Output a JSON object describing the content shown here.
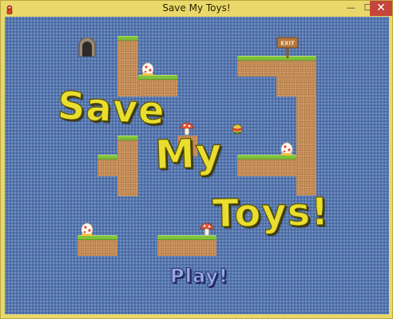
{
  "window": {
    "title": "Save My Toys!",
    "icon": "toy-app-icon",
    "controls": {
      "minimize": "—",
      "maximize": "☐",
      "close": "✕"
    }
  },
  "game": {
    "title_words": [
      "Save",
      "My",
      "Toys!"
    ],
    "play_button": {
      "label": "Play!"
    },
    "exit_sign": {
      "text": "EXIT"
    },
    "colors": {
      "sky": "#5577b0",
      "dirt": "#c8915c",
      "grass": "#7fc23a",
      "title_text": "#e9de2f",
      "play_text": "#9aa8e6"
    },
    "sprites": [
      "door-icon",
      "exit-sign-icon",
      "mushroom-icon",
      "egg-toy-icon",
      "ball-icon"
    ]
  }
}
